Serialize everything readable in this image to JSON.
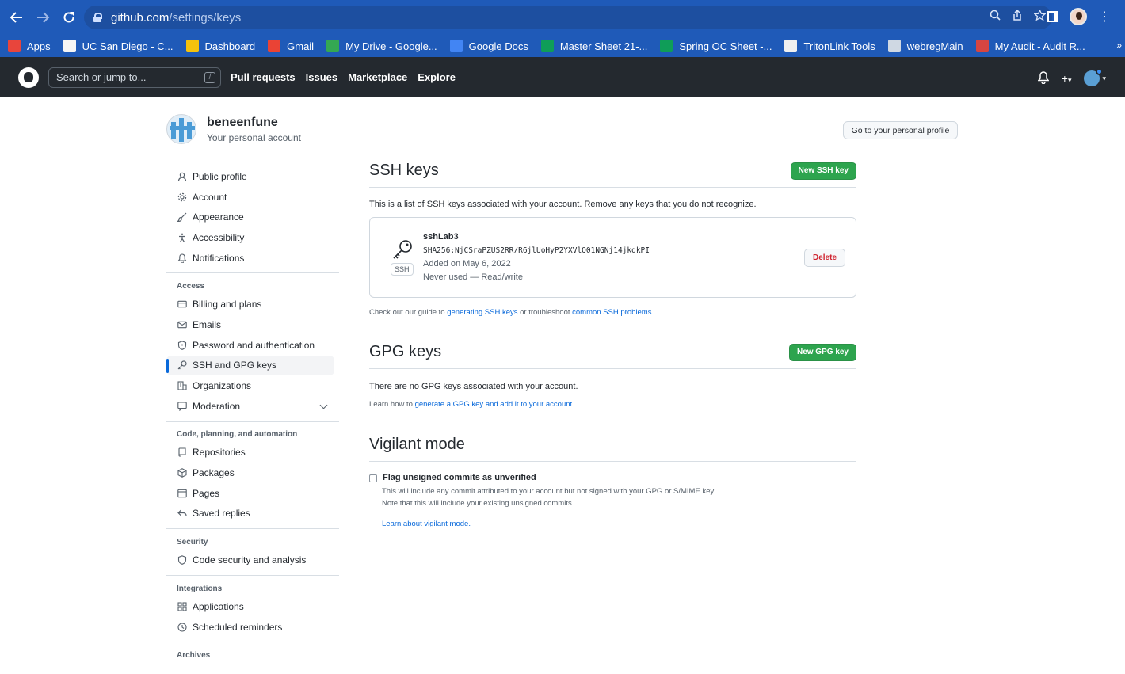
{
  "browser": {
    "url_host": "github.com",
    "url_path": "/settings/keys",
    "bookmarks": [
      {
        "label": "Apps",
        "color": "#e8453c"
      },
      {
        "label": "UC San Diego - C...",
        "color": "#f5f5f5"
      },
      {
        "label": "Dashboard",
        "color": "#f4c20d"
      },
      {
        "label": "Gmail",
        "color": "#ea4335"
      },
      {
        "label": "My Drive - Google...",
        "color": "#34a853"
      },
      {
        "label": "Google Docs",
        "color": "#4285f4"
      },
      {
        "label": "Master Sheet 21-...",
        "color": "#0f9d58"
      },
      {
        "label": "Spring OC Sheet -...",
        "color": "#0f9d58"
      },
      {
        "label": "TritonLink Tools",
        "color": "#f0f0f0"
      },
      {
        "label": "webregMain",
        "color": "#cfd8e3"
      },
      {
        "label": "My Audit - Audit R...",
        "color": "#d64541"
      }
    ],
    "bookmarks_more": "»"
  },
  "github": {
    "search_placeholder": "Search or jump to...",
    "search_key": "/",
    "nav": [
      "Pull requests",
      "Issues",
      "Marketplace",
      "Explore"
    ],
    "plus": "+",
    "caret": "▾"
  },
  "profile": {
    "username": "beneenfune",
    "subtitle": "Your personal account",
    "go_button": "Go to your personal profile"
  },
  "sidebar": {
    "top": [
      "Public profile",
      "Account",
      "Appearance",
      "Accessibility",
      "Notifications"
    ],
    "access_heading": "Access",
    "access": [
      "Billing and plans",
      "Emails",
      "Password and authentication",
      "SSH and GPG keys",
      "Organizations",
      "Moderation"
    ],
    "code_heading": "Code, planning, and automation",
    "code": [
      "Repositories",
      "Packages",
      "Pages",
      "Saved replies"
    ],
    "security_heading": "Security",
    "security": [
      "Code security and analysis"
    ],
    "integrations_heading": "Integrations",
    "integrations": [
      "Applications",
      "Scheduled reminders"
    ],
    "archives_heading": "Archives"
  },
  "ssh": {
    "title": "SSH keys",
    "new_button": "New SSH key",
    "description": "This is a list of SSH keys associated with your account. Remove any keys that you do not recognize.",
    "key": {
      "name": "sshLab3",
      "fingerprint": "SHA256:NjCSraPZUS2RR/R6jlUoHyP2YXVlQ01NGNj14jkdkPI",
      "added": "Added on May 6, 2022",
      "usage": "Never used — Read/write",
      "badge": "SSH",
      "delete": "Delete"
    },
    "guide_prefix": "Check out our guide to ",
    "guide_link": "generating SSH keys",
    "guide_mid": " or troubleshoot ",
    "guide_link2": "common SSH problems",
    "guide_suffix": "."
  },
  "gpg": {
    "title": "GPG keys",
    "new_button": "New GPG key",
    "description": "There are no GPG keys associated with your account.",
    "learn_prefix": "Learn how to ",
    "learn_link": "generate a GPG key and add it to your account",
    "learn_suffix": " ."
  },
  "vigilant": {
    "title": "Vigilant mode",
    "checkbox_label": "Flag unsigned commits as unverified",
    "desc1": "This will include any commit attributed to your account but not signed with your GPG or S/MIME key.",
    "desc2": "Note that this will include your existing unsigned commits.",
    "link": "Learn about vigilant mode."
  },
  "colors": {
    "chrome": "#1f5ab8",
    "header": "#24292f",
    "accent": "#0969da",
    "green": "#2da44e",
    "danger": "#cf222e"
  }
}
